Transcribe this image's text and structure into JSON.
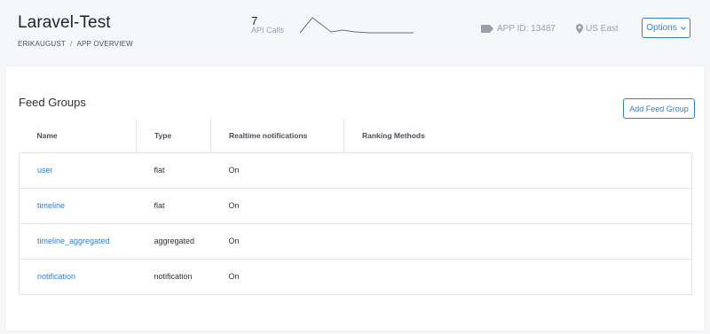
{
  "header": {
    "title": "Laravel-Test",
    "breadcrumb": {
      "org": "ERIKAUGUST",
      "separator": "/",
      "page": "APP OVERVIEW"
    },
    "api_calls": {
      "count": "7",
      "label": "API Calls"
    },
    "app_id": {
      "icon": "tag-icon",
      "text": "APP ID: 13487"
    },
    "region": {
      "icon": "map-pin-icon",
      "text": "US East"
    },
    "options_label": "Options",
    "options_icon": "chevron-down-icon"
  },
  "feed_groups": {
    "title": "Feed Groups",
    "add_label": "Add Feed Group",
    "columns": [
      "Name",
      "Type",
      "Realtime notifications",
      "Ranking Methods"
    ],
    "rows": [
      {
        "name": "user",
        "type": "flat",
        "realtime": "On",
        "ranking": ""
      },
      {
        "name": "timeline",
        "type": "flat",
        "realtime": "On",
        "ranking": ""
      },
      {
        "name": "timeline_aggregated",
        "type": "aggregated",
        "realtime": "On",
        "ranking": ""
      },
      {
        "name": "notification",
        "type": "notification",
        "realtime": "On",
        "ranking": ""
      }
    ]
  },
  "colors": {
    "accent": "#2f7fd4",
    "sparkline": "#6b7178",
    "muted": "#9aa0a8"
  }
}
